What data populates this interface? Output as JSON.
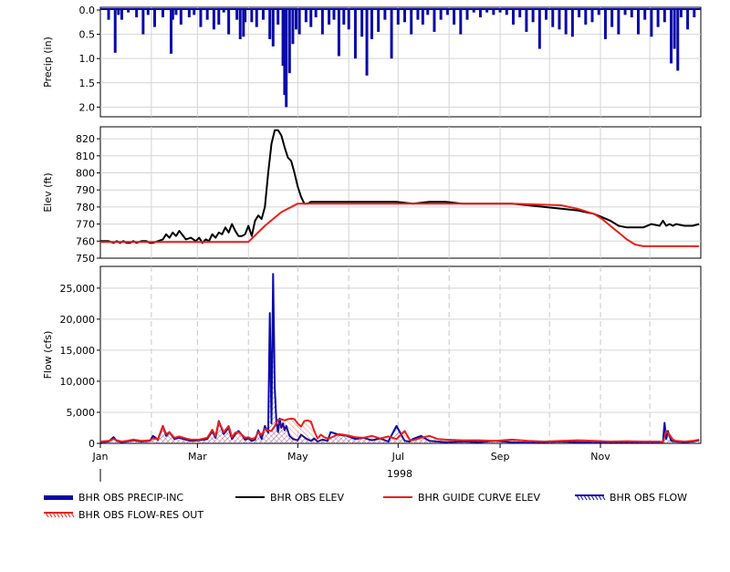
{
  "chart_data": [
    {
      "type": "bar",
      "panel": "precip",
      "ylabel": "Precip (in)",
      "ylim": [
        0,
        2.2
      ],
      "y_inverted": true,
      "yticks": [
        "0.0",
        "0.5",
        "1.0",
        "1.5",
        "2.0"
      ],
      "grid": true,
      "color": "#0a0aa8",
      "series": [
        {
          "name": "BHR OBS PRECIP-INC",
          "days": [
            5,
            9,
            11,
            13,
            17,
            22,
            26,
            29,
            33,
            38,
            43,
            44,
            46,
            49,
            54,
            57,
            61,
            65,
            69,
            72,
            75,
            78,
            83,
            85,
            87,
            88,
            92,
            95,
            99,
            103,
            105,
            108,
            111,
            112,
            113,
            115,
            117,
            119,
            121,
            125,
            128,
            131,
            135,
            139,
            142,
            145,
            148,
            151,
            155,
            159,
            162,
            165,
            169,
            173,
            177,
            181,
            185,
            189,
            193,
            196,
            199,
            203,
            207,
            211,
            215,
            219,
            223,
            227,
            231,
            235,
            239,
            243,
            247,
            251,
            255,
            259,
            263,
            267,
            271,
            275,
            279,
            283,
            287,
            291,
            295,
            299,
            303,
            307,
            311,
            315,
            319,
            323,
            327,
            331,
            335,
            339,
            343,
            347,
            349,
            351,
            353,
            357,
            361
          ],
          "values": [
            0.2,
            0.88,
            0.1,
            0.2,
            0.05,
            0.15,
            0.5,
            0.1,
            0.35,
            0.15,
            0.9,
            0.2,
            0.1,
            0.3,
            0.15,
            0.1,
            0.35,
            0.2,
            0.4,
            0.3,
            0.05,
            0.5,
            0.2,
            0.6,
            0.55,
            0.25,
            0.25,
            0.35,
            0.2,
            0.6,
            0.75,
            0.3,
            1.15,
            1.75,
            2.0,
            1.3,
            0.7,
            0.4,
            0.5,
            0.25,
            0.35,
            0.15,
            0.5,
            0.3,
            0.2,
            0.95,
            0.3,
            0.4,
            1.0,
            0.55,
            1.35,
            0.6,
            0.45,
            0.2,
            1.0,
            0.3,
            0.25,
            0.5,
            0.2,
            0.3,
            0.1,
            0.45,
            0.2,
            0.1,
            0.3,
            0.5,
            0.2,
            0.05,
            0.15,
            0.05,
            0.1,
            0.05,
            0.1,
            0.3,
            0.15,
            0.45,
            0.25,
            0.8,
            0.2,
            0.35,
            0.4,
            0.5,
            0.55,
            0.15,
            0.3,
            0.25,
            0.1,
            0.6,
            0.35,
            0.5,
            0.1,
            0.15,
            0.5,
            0.2,
            0.55,
            0.35,
            0.25,
            1.1,
            0.8,
            1.25,
            0.15,
            0.4,
            0.15
          ]
        }
      ]
    },
    {
      "type": "line",
      "panel": "elevation",
      "ylabel": "Elev (ft)",
      "ylim": [
        750,
        827
      ],
      "yticks": [
        "750",
        "760",
        "770",
        "780",
        "790",
        "800",
        "810",
        "820"
      ],
      "grid": true,
      "series": [
        {
          "name": "BHR OBS ELEV",
          "color": "#000000",
          "days": [
            0,
            5,
            8,
            10,
            12,
            14,
            16,
            18,
            20,
            22,
            25,
            28,
            30,
            32,
            35,
            38,
            40,
            42,
            44,
            46,
            48,
            52,
            55,
            58,
            60,
            62,
            64,
            66,
            68,
            70,
            72,
            74,
            76,
            78,
            80,
            82,
            84,
            86,
            88,
            90,
            92,
            94,
            96,
            98,
            100,
            102,
            104,
            106,
            108,
            110,
            112,
            114,
            116,
            118,
            120,
            122,
            124,
            126,
            128,
            130,
            132,
            134,
            140,
            150,
            160,
            170,
            180,
            190,
            200,
            210,
            220,
            230,
            240,
            250,
            260,
            270,
            280,
            290,
            300,
            305,
            310,
            315,
            320,
            325,
            330,
            335,
            340,
            342,
            344,
            346,
            348,
            350,
            355,
            360,
            364
          ],
          "values": [
            760,
            760,
            759,
            760,
            759,
            760,
            759,
            759,
            760,
            759,
            760,
            760,
            759,
            759,
            760,
            761,
            764,
            762,
            765,
            763,
            766,
            761,
            762,
            760,
            762,
            759,
            761,
            760,
            764,
            762,
            765,
            764,
            768,
            765,
            770,
            766,
            763,
            763,
            764,
            769,
            763,
            772,
            775,
            773,
            780,
            800,
            817,
            825,
            825,
            822,
            815,
            809,
            807,
            800,
            792,
            786,
            782,
            782,
            783,
            783,
            783,
            783,
            783,
            783,
            783,
            783,
            783,
            782,
            783,
            783,
            782,
            782,
            782,
            782,
            781,
            780,
            779,
            778,
            776,
            774,
            772,
            769,
            768,
            768,
            768,
            770,
            769,
            772,
            769,
            770,
            769,
            770,
            769,
            769,
            770
          ]
        },
        {
          "name": "BHR GUIDE CURVE ELEV",
          "color": "#e8201a",
          "days": [
            0,
            90,
            100,
            110,
            120,
            130,
            140,
            250,
            280,
            290,
            300,
            305,
            310,
            315,
            320,
            325,
            330,
            335,
            364
          ],
          "values": [
            759.5,
            759.5,
            769,
            777,
            782,
            782,
            782,
            782,
            781,
            779,
            776,
            773,
            769,
            765,
            761,
            758,
            757,
            757,
            757
          ]
        }
      ]
    },
    {
      "type": "area",
      "panel": "flow",
      "ylabel": "Flow (cfs)",
      "ylim": [
        0,
        28500
      ],
      "yticks": [
        "0",
        "5,000",
        "10,000",
        "15,000",
        "20,000",
        "25,000"
      ],
      "grid": true,
      "x_tick_labels": [
        "Jan",
        "Mar",
        "May",
        "Jul",
        "Sep",
        "Nov"
      ],
      "x_year_label": "1998",
      "series": [
        {
          "name": "BHR OBS FLOW",
          "color": "#0a0aa8",
          "hatched": true,
          "days": [
            0,
            5,
            8,
            10,
            13,
            16,
            20,
            25,
            30,
            32,
            35,
            38,
            40,
            42,
            45,
            48,
            52,
            55,
            60,
            65,
            68,
            70,
            72,
            75,
            78,
            80,
            82,
            84,
            86,
            88,
            90,
            92,
            94,
            96,
            98,
            100,
            102,
            103,
            104,
            105,
            106,
            107,
            108,
            109,
            110,
            111,
            112,
            113,
            115,
            117,
            120,
            122,
            125,
            128,
            130,
            132,
            135,
            138,
            140,
            145,
            150,
            155,
            160,
            165,
            170,
            175,
            180,
            185,
            188,
            190,
            195,
            200,
            205,
            210,
            220,
            230,
            240,
            250,
            260,
            270,
            280,
            290,
            300,
            310,
            320,
            330,
            340,
            342,
            343,
            344,
            345,
            347,
            350,
            355,
            360,
            364
          ],
          "values": [
            200,
            300,
            1000,
            400,
            200,
            300,
            500,
            300,
            400,
            1200,
            600,
            2800,
            1200,
            1800,
            700,
            900,
            600,
            400,
            500,
            700,
            2000,
            900,
            3600,
            1500,
            2500,
            700,
            1500,
            2000,
            1400,
            600,
            800,
            400,
            600,
            2100,
            700,
            2800,
            1700,
            21000,
            3200,
            27300,
            9000,
            3500,
            1800,
            4000,
            2500,
            3200,
            2100,
            2800,
            1200,
            700,
            500,
            1400,
            800,
            400,
            800,
            300,
            600,
            400,
            1800,
            1400,
            1200,
            700,
            900,
            500,
            800,
            300,
            2800,
            400,
            300,
            700,
            1200,
            400,
            300,
            200,
            300,
            200,
            400,
            200,
            100,
            200,
            300,
            200,
            100,
            200,
            200,
            150,
            100,
            200,
            3300,
            700,
            2000,
            400,
            300,
            200,
            300,
            500
          ]
        },
        {
          "name": "BHR OBS FLOW-RES OUT",
          "color": "#e8201a",
          "hatched": true,
          "days": [
            0,
            5,
            8,
            10,
            13,
            16,
            20,
            25,
            30,
            32,
            35,
            38,
            40,
            42,
            45,
            48,
            52,
            55,
            60,
            65,
            68,
            70,
            72,
            75,
            78,
            80,
            82,
            84,
            86,
            88,
            90,
            92,
            94,
            96,
            98,
            100,
            102,
            104,
            106,
            108,
            110,
            112,
            114,
            116,
            118,
            120,
            122,
            124,
            126,
            128,
            130,
            132,
            134,
            136,
            138,
            140,
            145,
            150,
            155,
            160,
            165,
            170,
            175,
            180,
            185,
            188,
            190,
            195,
            200,
            205,
            210,
            220,
            230,
            240,
            250,
            260,
            270,
            280,
            290,
            300,
            310,
            320,
            330,
            340,
            342,
            344,
            346,
            348,
            350,
            355,
            360,
            364
          ],
          "values": [
            300,
            400,
            700,
            500,
            300,
            400,
            600,
            400,
            500,
            800,
            700,
            2800,
            1500,
            1800,
            900,
            1100,
            800,
            600,
            600,
            900,
            2200,
            1200,
            3500,
            1800,
            2800,
            1000,
            1700,
            1800,
            1400,
            900,
            1000,
            700,
            900,
            1800,
            1400,
            2300,
            2100,
            2000,
            2800,
            3800,
            3900,
            3700,
            3900,
            4000,
            3900,
            3200,
            2700,
            3600,
            3700,
            3500,
            2000,
            800,
            1400,
            1000,
            800,
            900,
            1500,
            1300,
            1000,
            900,
            1200,
            800,
            1100,
            700,
            2000,
            600,
            500,
            900,
            1200,
            700,
            600,
            500,
            500,
            400,
            600,
            400,
            300,
            400,
            500,
            400,
            300,
            350,
            300,
            300,
            200,
            2000,
            1400,
            600,
            400,
            300,
            400,
            600
          ]
        }
      ]
    }
  ],
  "legend": [
    {
      "label": "BHR OBS PRECIP-INC",
      "style": "thick-bar",
      "color": "#0a0aa8"
    },
    {
      "label": "BHR OBS ELEV",
      "style": "line",
      "color": "#000000"
    },
    {
      "label": "BHR GUIDE CURVE ELEV",
      "style": "line",
      "color": "#e8201a"
    },
    {
      "label": "BHR OBS FLOW",
      "style": "hatch",
      "color": "#0a0aa8"
    },
    {
      "label": "BHR OBS FLOW-RES OUT",
      "style": "hatch",
      "color": "#e8201a"
    }
  ]
}
